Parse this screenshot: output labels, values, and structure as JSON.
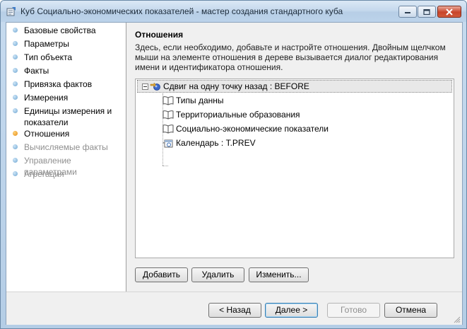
{
  "window": {
    "title": "Куб Социально-экономических показателей - мастер создания стандартного куба",
    "icon": "cube-wizard-icon",
    "controls": [
      "minimize-icon",
      "maximize-icon",
      "close-icon"
    ]
  },
  "steps": [
    {
      "label": "Базовые свойства",
      "state": "done"
    },
    {
      "label": "Параметры",
      "state": "done"
    },
    {
      "label": "Тип объекта",
      "state": "done"
    },
    {
      "label": "Факты",
      "state": "done"
    },
    {
      "label": "Привязка фактов",
      "state": "done"
    },
    {
      "label": "Измерения",
      "state": "done"
    },
    {
      "label": "Единицы измерения и показатели",
      "state": "done"
    },
    {
      "label": "Отношения",
      "state": "active"
    },
    {
      "label": "Вычисляемые факты",
      "state": "disabled"
    },
    {
      "label": "Управление параметрами",
      "state": "disabled"
    },
    {
      "label": "Агрегация",
      "state": "disabled"
    }
  ],
  "page": {
    "title": "Отношения",
    "description": "Здесь, если необходимо, добавьте и настройте отношения. Двойным щелчком мыши на элементе отношения в дереве вызывается диалог редактирования имени и идентификатора отношения."
  },
  "tree": {
    "root": {
      "label": "Сдвиг на одну точку назад : BEFORE",
      "icon": "relation-shift-icon",
      "expanded": true
    },
    "children": [
      {
        "label": "Типы данны",
        "icon": "dictionary-book-icon"
      },
      {
        "label": "Территориальные образования",
        "icon": "dictionary-book-icon"
      },
      {
        "label": "Социально-экономические показатели",
        "icon": "dictionary-book-icon"
      },
      {
        "label": "Календарь : T.PREV",
        "icon": "calendar-relation-icon"
      }
    ]
  },
  "actions": {
    "add": "Добавить",
    "delete": "Удалить",
    "edit": "Изменить..."
  },
  "nav": {
    "back": "< Назад",
    "next": "Далее >",
    "finish": "Готово",
    "cancel": "Отмена"
  },
  "colors": {
    "active_step_dot": "#e38a12",
    "step_dot": "#6da5d2",
    "disabled_text": "#8f8f8f"
  }
}
